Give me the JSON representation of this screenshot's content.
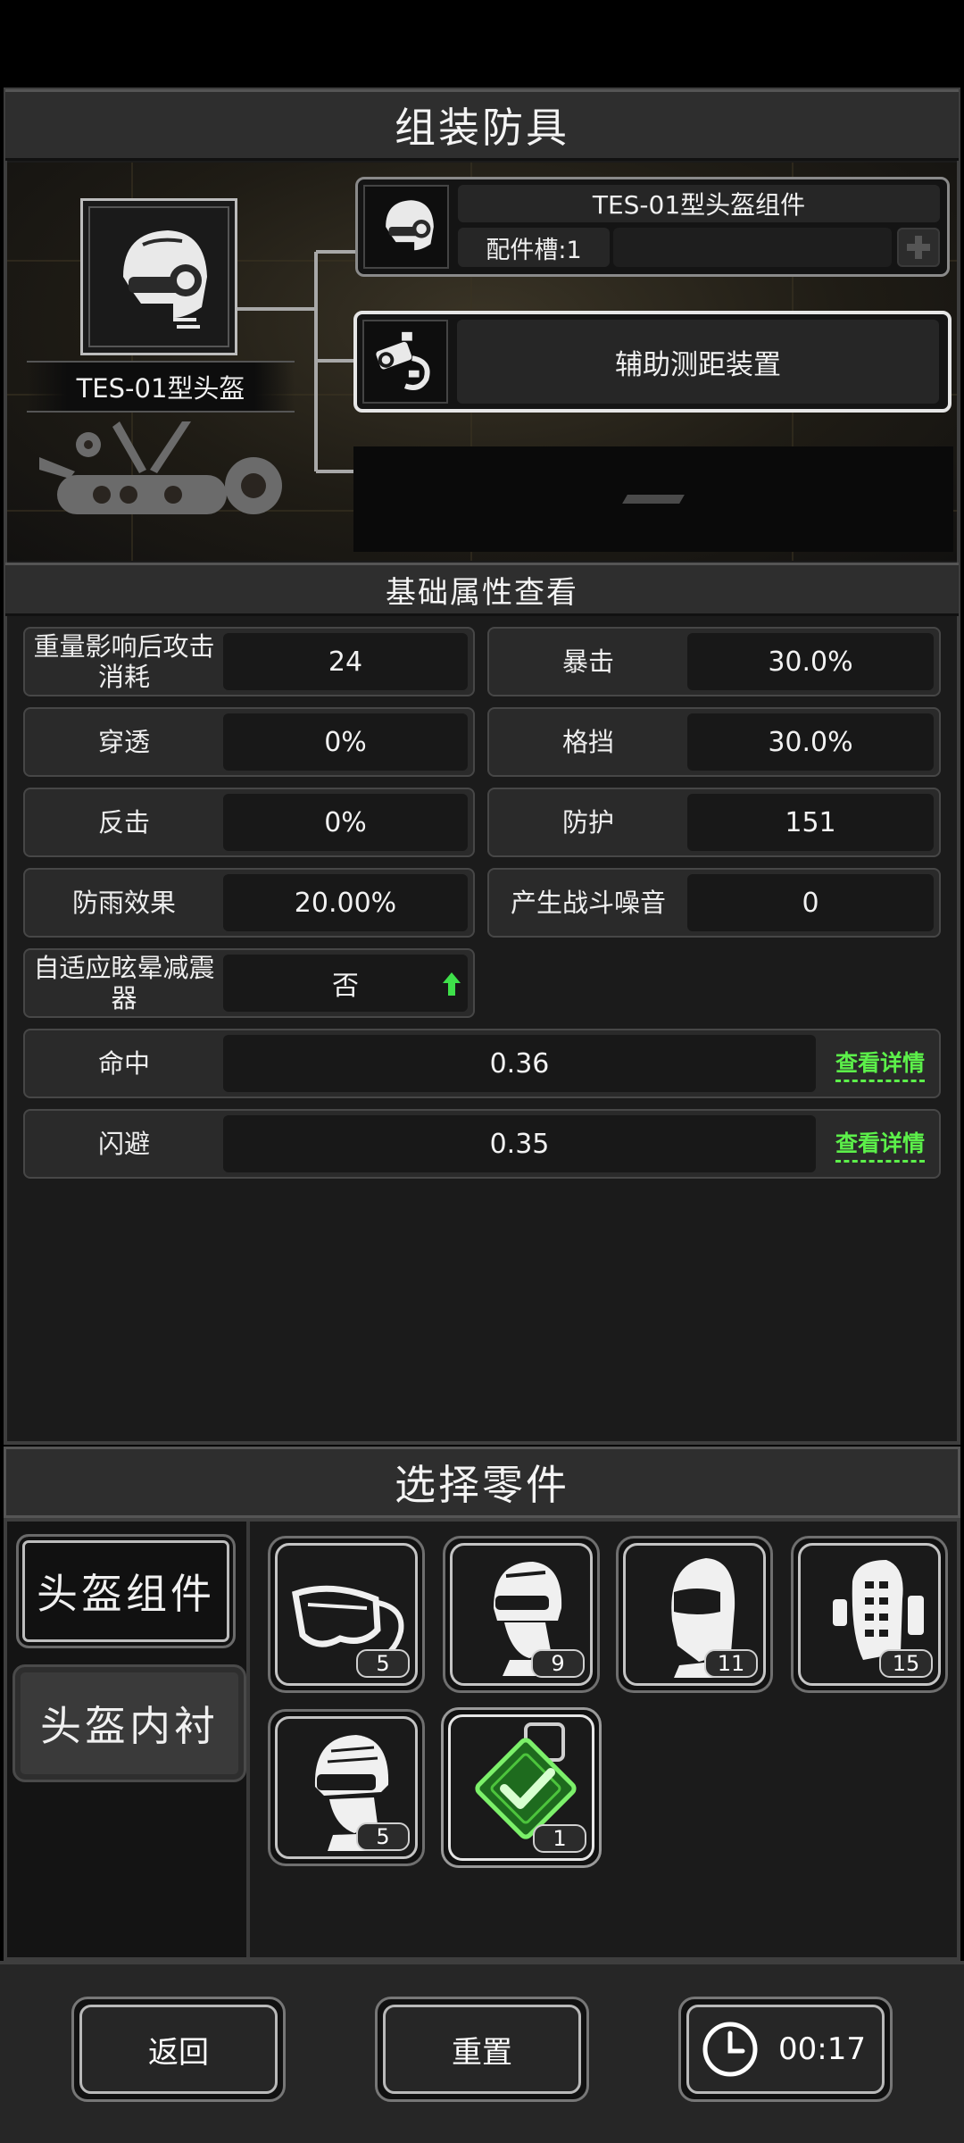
{
  "header": {
    "title": "组装防具"
  },
  "equipment": {
    "name": "TES-01型头盔",
    "component": {
      "name": "TES-01型头盔组件",
      "slots_label": "配件槽:1"
    },
    "accessory": {
      "name": "辅助测距装置"
    }
  },
  "stats_section": {
    "title": "基础属性查看"
  },
  "stats": [
    {
      "label": "重量影响后攻击消耗",
      "value": "24"
    },
    {
      "label": "暴击",
      "value": "30.0%"
    },
    {
      "label": "穿透",
      "value": "0%"
    },
    {
      "label": "格挡",
      "value": "30.0%"
    },
    {
      "label": "反击",
      "value": "0%"
    },
    {
      "label": "防护",
      "value": "151"
    },
    {
      "label": "防雨效果",
      "value": "20.00%"
    },
    {
      "label": "产生战斗噪音",
      "value": "0"
    },
    {
      "label": "自适应眩晕减震器",
      "value": "否"
    }
  ],
  "wide_stats": [
    {
      "label": "命中",
      "value": "0.36",
      "link": "查看详情"
    },
    {
      "label": "闪避",
      "value": "0.35",
      "link": "查看详情"
    }
  ],
  "parts_section": {
    "title": "选择零件",
    "tabs": [
      "头盔组件",
      "头盔内衬"
    ],
    "items": [
      {
        "icon": "goggles-icon",
        "count": "5"
      },
      {
        "icon": "helmet-visor-icon",
        "count": "9"
      },
      {
        "icon": "full-mask-icon",
        "count": "11"
      },
      {
        "icon": "padded-liner-icon",
        "count": "15"
      },
      {
        "icon": "tactical-helmet-icon",
        "count": "5"
      },
      {
        "icon": "selected-chip-icon",
        "count": "1"
      }
    ]
  },
  "footer": {
    "back_label": "返回",
    "reset_label": "重置",
    "timer": "00:17"
  },
  "colors": {
    "accent_green": "#5cf04a",
    "panel_bg": "#1b1b1b",
    "frame": "#3e3e3e"
  }
}
